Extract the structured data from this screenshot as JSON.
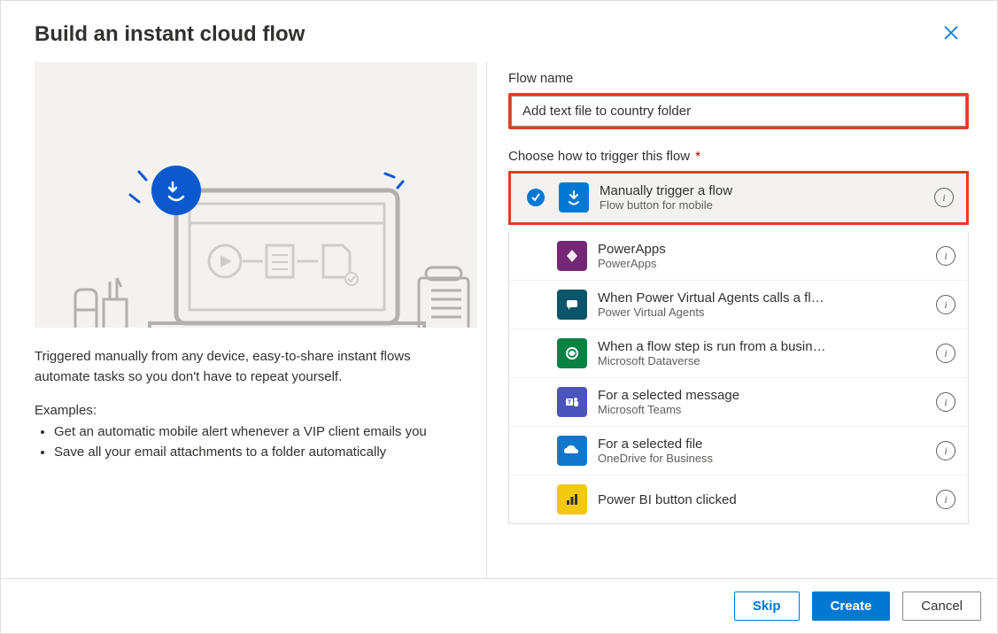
{
  "header": {
    "title": "Build an instant cloud flow"
  },
  "left": {
    "description": "Triggered manually from any device, easy-to-share instant flows automate tasks so you don't have to repeat yourself.",
    "examples_heading": "Examples:",
    "examples": [
      "Get an automatic mobile alert whenever a VIP client emails you",
      "Save all your email attachments to a folder automatically"
    ]
  },
  "right": {
    "flow_name_label": "Flow name",
    "flow_name_value": "Add text file to country folder",
    "trigger_label": "Choose how to trigger this flow",
    "triggers": [
      {
        "title": "Manually trigger a flow",
        "subtitle": "Flow button for mobile",
        "selected": true,
        "icon_bg": "#0078d4",
        "icon": "touch"
      },
      {
        "title": "PowerApps",
        "subtitle": "PowerApps",
        "selected": false,
        "icon_bg": "#742774",
        "icon": "powerapps"
      },
      {
        "title": "When Power Virtual Agents calls a fl…",
        "subtitle": "Power Virtual Agents",
        "selected": false,
        "icon_bg": "#0b556a",
        "icon": "pva"
      },
      {
        "title": "When a flow step is run from a busin…",
        "subtitle": "Microsoft Dataverse",
        "selected": false,
        "icon_bg": "#088142",
        "icon": "dataverse"
      },
      {
        "title": "For a selected message",
        "subtitle": "Microsoft Teams",
        "selected": false,
        "icon_bg": "#4b53bc",
        "icon": "teams"
      },
      {
        "title": "For a selected file",
        "subtitle": "OneDrive for Business",
        "selected": false,
        "icon_bg": "#1078ca",
        "icon": "onedrive"
      },
      {
        "title": "Power BI button clicked",
        "subtitle": "",
        "selected": false,
        "icon_bg": "#f2c811",
        "icon": "powerbi"
      }
    ]
  },
  "footer": {
    "skip": "Skip",
    "create": "Create",
    "cancel": "Cancel"
  }
}
